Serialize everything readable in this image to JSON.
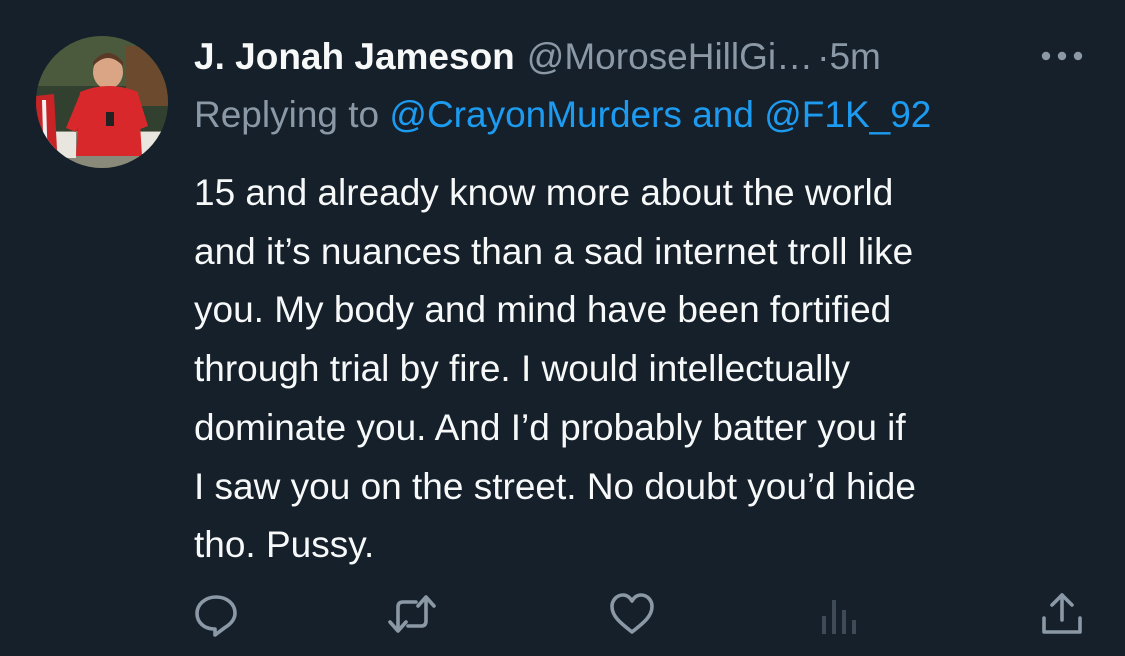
{
  "tweet": {
    "display_name": "J. Jonah Jameson",
    "handle": "@MoroseHillGi…",
    "dot": "·",
    "timestamp": "5m",
    "replying_prefix": "Replying to",
    "mention_1": "@CrayonMurders",
    "mention_joiner": "and",
    "mention_2": "@F1K_92",
    "body_lines": [
      "15 and already know more about the world",
      "and it’s nuances than a sad internet troll like",
      "you. My body and mind have been fortified",
      "through trial by fire. I would intellectually",
      "dominate you. And I’d probably batter you if",
      "I saw you on the street. No doubt you’d hide",
      "tho. Pussy."
    ]
  },
  "icons": {
    "more": "more-dots-icon",
    "reply": "reply-bubble-icon",
    "retweet": "retweet-arrows-icon",
    "like": "heart-icon",
    "views": "bar-chart-icon",
    "share": "share-upload-icon"
  },
  "colors": {
    "background": "#15202b",
    "text": "#f7f9f9",
    "muted": "#8b98a5",
    "link": "#1d9bf0",
    "views_icon": "#3e4a56",
    "avatar_shirt": "#d8282b"
  }
}
